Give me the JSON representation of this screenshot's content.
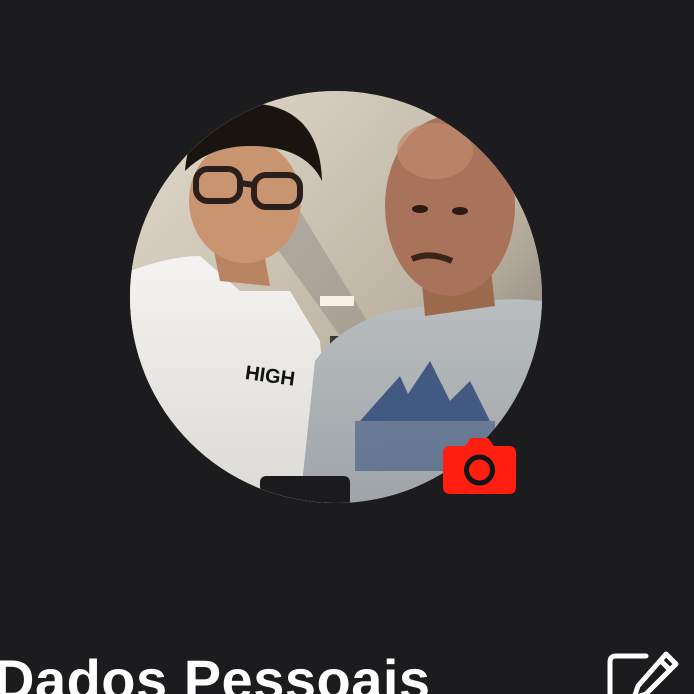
{
  "profile": {
    "photo_description": "profile-photo",
    "camera_badge_icon": "camera-icon",
    "accent_color": "#ff1e10"
  },
  "section": {
    "title": "Dados Pessoais",
    "edit_icon": "edit-icon"
  },
  "theme": {
    "background": "#1c1c1e",
    "text": "#ffffff"
  }
}
